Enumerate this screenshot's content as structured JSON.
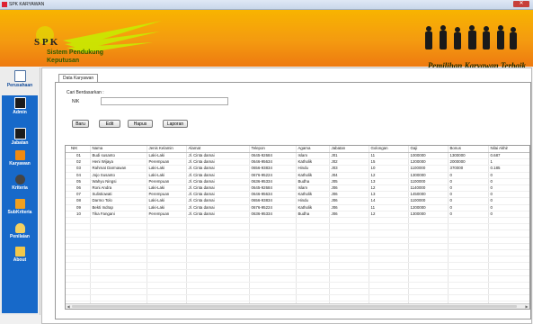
{
  "window": {
    "title": "SPK KARYAWAN",
    "close": "✕"
  },
  "banner": {
    "logo_spk": "S P K",
    "logo_line1": "Sistem Pendukung",
    "logo_line2": "Keputusan",
    "tagline": "Pemilihan Karyawan Terbaik"
  },
  "sidebar": {
    "items": [
      {
        "label": "Perusahaan",
        "icon": "home-icon"
      },
      {
        "label": "Admin",
        "icon": "app-icon"
      },
      {
        "label": "Jabatan",
        "icon": "app-icon"
      },
      {
        "label": "Karyawan",
        "icon": "sun-icon"
      },
      {
        "label": "Kriteria",
        "icon": "disc-icon"
      },
      {
        "label": "SubKriteria",
        "icon": "check-icon"
      },
      {
        "label": "Penilaian",
        "icon": "user-icon"
      },
      {
        "label": "About",
        "icon": "figure-icon"
      }
    ]
  },
  "tab": "Data Karyawan",
  "search": {
    "group_label": "Cari Berdasarkan :",
    "nik_label": "NIK",
    "value": ""
  },
  "buttons": {
    "baru": "Baru",
    "edit": "Edit",
    "hapus": "Hapus",
    "laporan": "Laporan"
  },
  "columns": [
    "NIK",
    "Nama",
    "Jenis Kelamin",
    "Alamat",
    "Telepon",
    "Agama",
    "Jabatan",
    "Golongan",
    "Gaji",
    "Bonus",
    "Nilai Akhir"
  ],
  "rows": [
    [
      "01",
      "Budi susanto",
      "Laki-Laki",
      "Jl. Cinta damai",
      "0645-92684",
      "Islam",
      "J01",
      "11",
      "1000000",
      "1300000",
      "0.687"
    ],
    [
      "02",
      "Heni Wijaya",
      "Perempuan",
      "Jl. Cinta damai",
      "0646-95634",
      "Katholik",
      "J02",
      "15",
      "1200000",
      "2000000",
      "1"
    ],
    [
      "03",
      "Rahmat Darmawan",
      "Laki-Laki",
      "Jl. Cinta damai",
      "0656-93834",
      "Hindu",
      "J03",
      "10",
      "1100000",
      "370000",
      "0.185"
    ],
    [
      "04",
      "Jojo Susanto",
      "Laki-Laki",
      "Jl. Cinta damai",
      "0676-95224",
      "Katholik",
      "J04",
      "12",
      "1300000",
      "0",
      "0"
    ],
    [
      "05",
      "Wahyu Ningsi",
      "Perempuan",
      "Jl. Cinta damai",
      "0636-95334",
      "Budha",
      "J05",
      "13",
      "1100000",
      "0",
      "0"
    ],
    [
      "06",
      "Roni Andra",
      "Laki-Laki",
      "Jl. Cinta damai",
      "0645-92684",
      "Islam",
      "J06",
      "12",
      "1140000",
      "0",
      "0"
    ],
    [
      "07",
      "Sulistiowati",
      "Perempuan",
      "Jl. Cinta damai",
      "0646-95634",
      "Katholik",
      "J06",
      "13",
      "1450000",
      "0",
      "0"
    ],
    [
      "08",
      "Darmo Tolo",
      "Laki-Laki",
      "Jl. Cinta damai",
      "0656-93834",
      "Hindu",
      "J06",
      "14",
      "1100000",
      "0",
      "0"
    ],
    [
      "09",
      "Bekti Indrap",
      "Laki-Laki",
      "Jl. Cinta damai",
      "0676-95224",
      "Katholik",
      "J06",
      "11",
      "1200000",
      "0",
      "0"
    ],
    [
      "10",
      "Tika Fangani",
      "Perempuan",
      "Jl. Cinta damai",
      "0636-95334",
      "Budha",
      "J06",
      "12",
      "1300000",
      "0",
      "0"
    ]
  ],
  "empty_rows": 15,
  "colors": {
    "banner": "#f49a10",
    "sidebar": "#1769c9"
  }
}
